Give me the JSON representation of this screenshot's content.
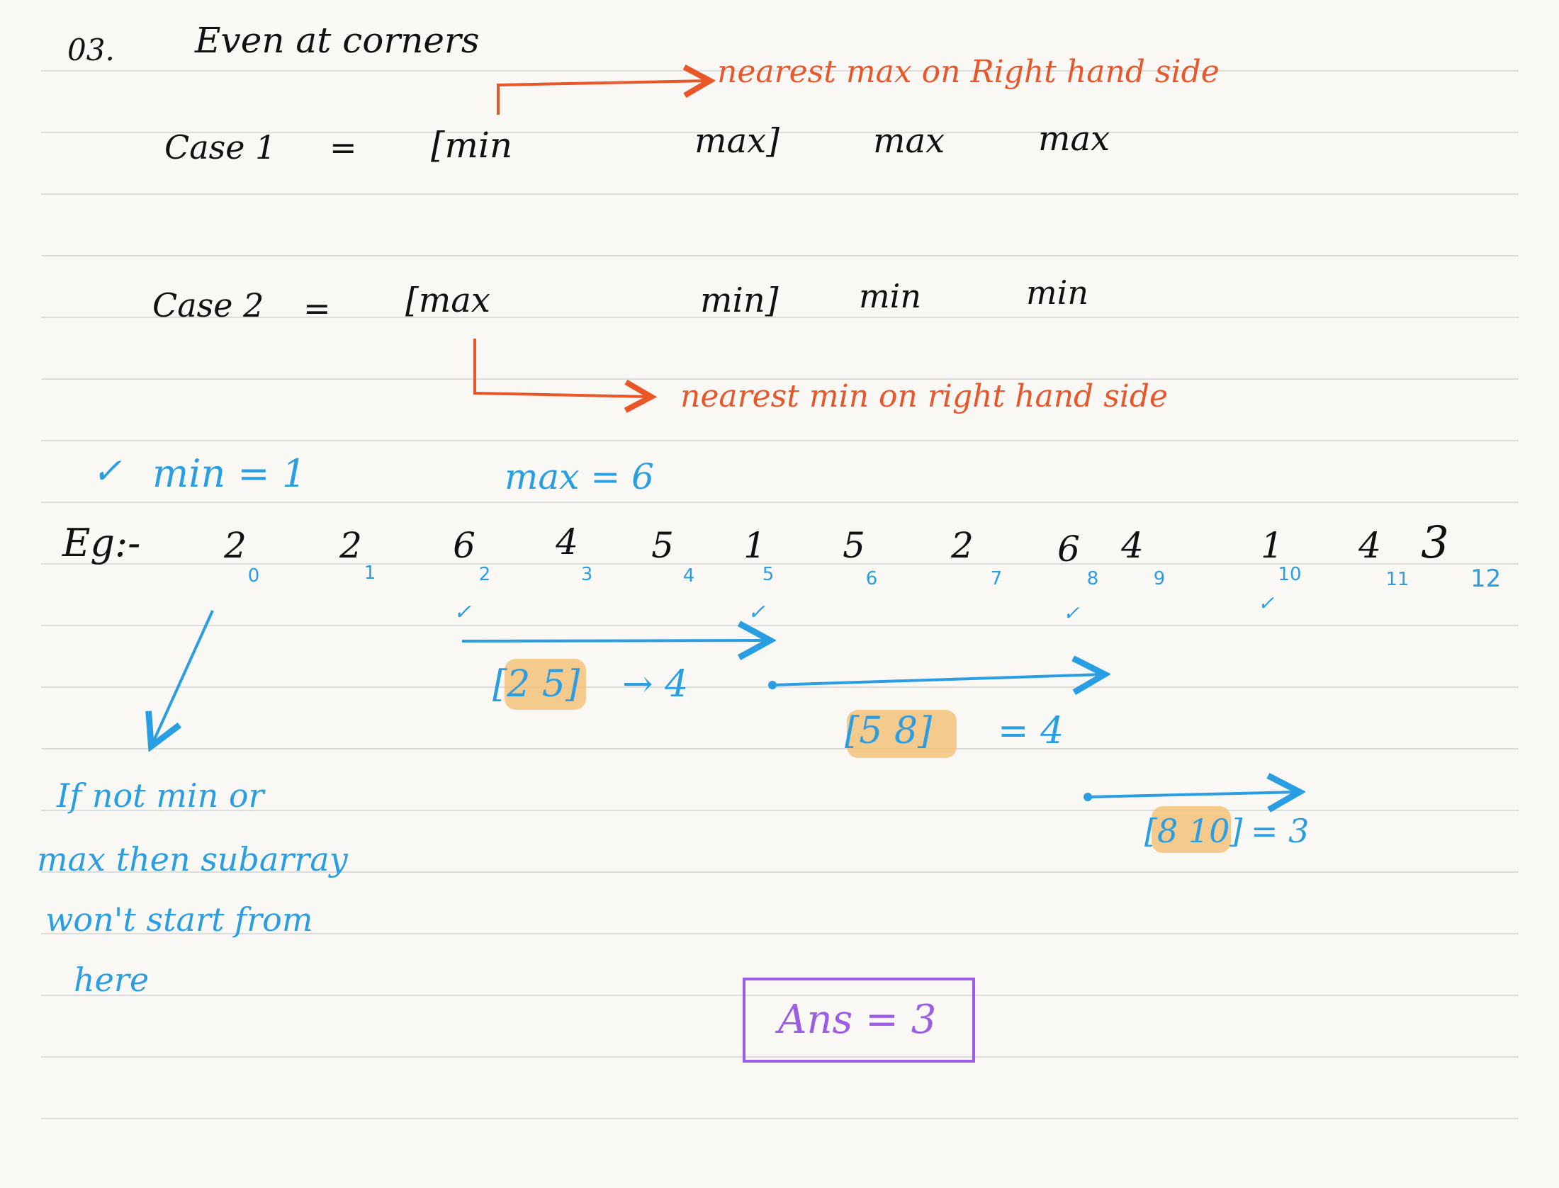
{
  "heading": {
    "number": "03.",
    "title": "Even at corners"
  },
  "case1": {
    "label": "Case 1",
    "equals": "=",
    "first": "[min",
    "second": "max]",
    "third": "max",
    "fourth": "max",
    "note": "nearest max on Right hand side"
  },
  "case2": {
    "label": "Case 2",
    "equals": "=",
    "first": "[max",
    "second": "min]",
    "third": "min",
    "fourth": "min",
    "note": "nearest min on right hand side"
  },
  "min_label": "min = 1",
  "max_label": "max = 6",
  "check_mark": "✓",
  "example": {
    "label": "Eg:-",
    "values": [
      "2",
      "2",
      "6",
      "4",
      "5",
      "1",
      "5",
      "2",
      "6",
      "4",
      "1",
      "4",
      "3"
    ],
    "indices": [
      "0",
      "1",
      "2",
      "3",
      "4",
      "5",
      "6",
      "7",
      "8",
      "9",
      "10",
      "11",
      "12"
    ]
  },
  "ranges": [
    {
      "range": "[2 5]",
      "result": "→ 4"
    },
    {
      "range": "[5 8]",
      "result": "= 4"
    },
    {
      "range": "[8 10]",
      "result": "= 3"
    }
  ],
  "side_note": [
    "If not min or",
    "max then subarray",
    "won't start from",
    "here"
  ],
  "answer": "Ans = 3",
  "colors": {
    "ink": "#111111",
    "red": "#e8572a",
    "blue": "#2a9ee3",
    "purple": "#9b5de5",
    "highlight": "#f5c27a"
  }
}
